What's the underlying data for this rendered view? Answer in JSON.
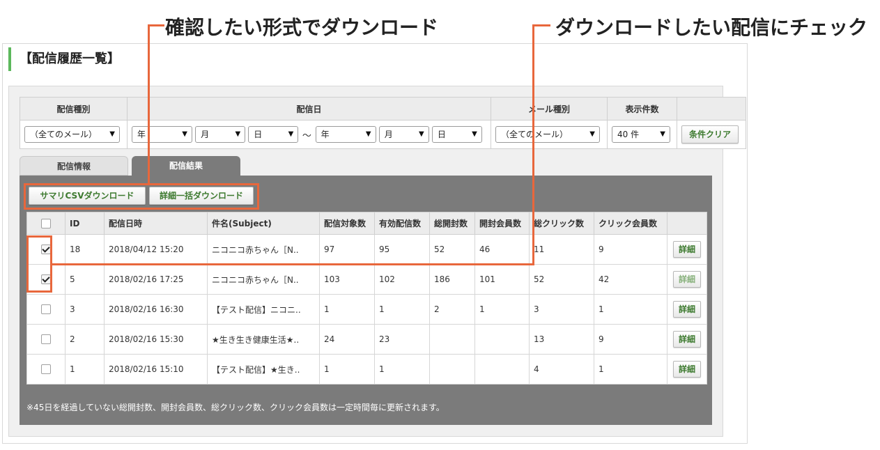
{
  "callouts": {
    "left": "確認したい形式でダウンロード",
    "right": "ダウンロードしたい配信にチェック"
  },
  "page_title": "【配信履歴一覧】",
  "filter": {
    "headers": {
      "type": "配信種別",
      "date": "配信日",
      "mail_type": "メール種別",
      "count": "表示件数"
    },
    "type_value": "（全てのメール）",
    "from_year": "年",
    "from_month": "月",
    "from_day": "日",
    "tilde": "～",
    "to_year": "年",
    "to_month": "月",
    "to_day": "日",
    "mail_type_value": "（全てのメール）",
    "count_value": "40 件",
    "clear_button": "条件クリア"
  },
  "tabs": {
    "info": "配信情報",
    "result": "配信結果"
  },
  "download": {
    "summary_csv": "サマリCSVダウンロード",
    "detail_bulk": "詳細一括ダウンロード"
  },
  "table": {
    "headers": [
      "ID",
      "配信日時",
      "件名(Subject)",
      "配信対象数",
      "有効配信数",
      "総開封数",
      "開封会員数",
      "総クリック数",
      "クリック会員数"
    ],
    "detail_label": "詳細",
    "rows": [
      {
        "checked": true,
        "id": "18",
        "datetime": "2018/04/12 15:20",
        "subject": "ニコニコ赤ちゃん［N..",
        "target": "97",
        "valid": "95",
        "opens": "52",
        "open_members": "46",
        "clicks": "11",
        "click_members": "9",
        "detail_disabled": false
      },
      {
        "checked": true,
        "id": "5",
        "datetime": "2018/02/16 17:25",
        "subject": "ニコニコ赤ちゃん［N..",
        "target": "103",
        "valid": "102",
        "opens": "186",
        "open_members": "101",
        "clicks": "52",
        "click_members": "42",
        "detail_disabled": true
      },
      {
        "checked": false,
        "id": "3",
        "datetime": "2018/02/16 16:30",
        "subject": "【テスト配信】ニコニ..",
        "target": "1",
        "valid": "1",
        "opens": "2",
        "open_members": "1",
        "clicks": "3",
        "click_members": "1",
        "detail_disabled": false
      },
      {
        "checked": false,
        "id": "2",
        "datetime": "2018/02/16 15:30",
        "subject": "★生き生き健康生活★..",
        "target": "24",
        "valid": "23",
        "opens": "",
        "open_members": "",
        "clicks": "13",
        "click_members": "9",
        "detail_disabled": false
      },
      {
        "checked": false,
        "id": "1",
        "datetime": "2018/02/16 15:10",
        "subject": "【テスト配信】★生き..",
        "target": "1",
        "valid": "1",
        "opens": "",
        "open_members": "",
        "clicks": "4",
        "click_members": "1",
        "detail_disabled": false
      }
    ]
  },
  "note": "※45日を経過していない総開封数、開封会員数、総クリック数、クリック会員数は一定時間毎に更新されます。",
  "colors": {
    "callout": "#e8673c",
    "accent_green": "#5cb85c",
    "tab_active": "#7b7b7b",
    "button_text": "#3d7a2f"
  }
}
